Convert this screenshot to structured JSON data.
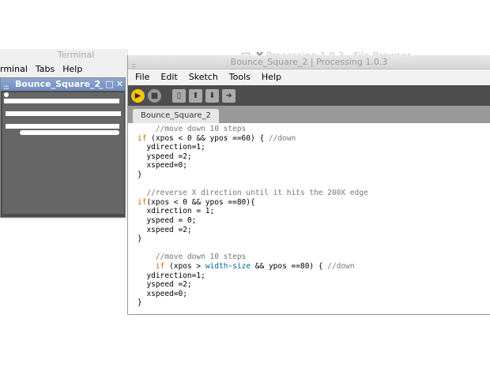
{
  "background": {
    "terminal_title": "Terminal",
    "terminal_menu": [
      "rminal",
      "Tabs",
      "Help"
    ],
    "ghost_title": "Processing 1.0.3 - File Browser"
  },
  "mini_window": {
    "title": "Bounce_Square_2",
    "controls": [
      "_",
      "□",
      "✕"
    ]
  },
  "ide": {
    "title": "Bounce_Square_2 | Processing 1.0.3",
    "menu": [
      "File",
      "Edit",
      "Sketch",
      "Tools",
      "Help"
    ],
    "toolbar": {
      "run": "run-icon",
      "stop": "stop-icon",
      "new": "new-icon",
      "open": "open-icon",
      "save": "save-icon",
      "export": "export-icon"
    },
    "tab_label": "Bounce_Square_2"
  },
  "code_lines": [
    "    //move down 10 steps",
    "if (xpos < 0 && ypos ==60) { //down",
    "  ydirection=1;",
    "  yspeed =2;",
    "  xspeed=0;",
    "}",
    "",
    "  //reverse X direction until it hits the 200X edge",
    "if(xpos < 0 && ypos ==80){",
    "  xdirection = 1;",
    "  yspeed = 0;",
    "  xspeed =2;",
    "}",
    "",
    "    //move down 10 steps",
    "    if (xpos > width-size && ypos ==80) { //down",
    "  ydirection=1;",
    "  yspeed =2;",
    "  xspeed=0;",
    "}"
  ],
  "colors": {
    "toolbar_bg": "#4d4d4d",
    "run_button": "#f6c700",
    "tab_strip": "#999999",
    "comment": "#777777",
    "keyword": "#cc6600"
  }
}
